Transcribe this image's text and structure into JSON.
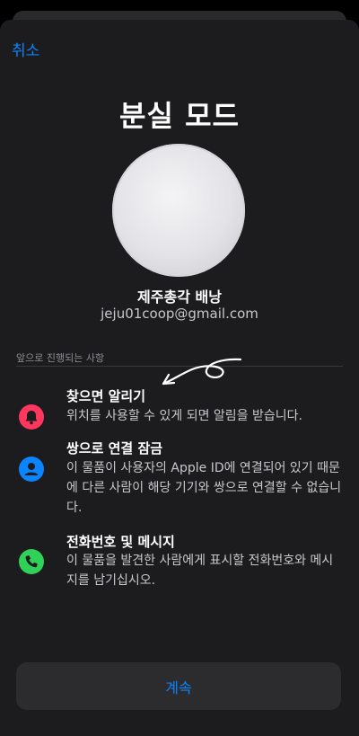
{
  "header": {
    "cancel_label": "취소"
  },
  "title": "분실 모드",
  "item": {
    "name": "제주총각 배낭",
    "email": "jeju01coop@gmail.com"
  },
  "section_header": "앞으로 진행되는 사항",
  "features": [
    {
      "title": "찾으면 알리기",
      "description": "위치를 사용할 수 있게 되면 알림을 받습니다.",
      "icon": "bell-icon",
      "color": "#ff375f"
    },
    {
      "title": "쌍으로 연결 잠금",
      "description": "이 물품이 사용자의 Apple ID에 연결되어 있기 때문에 다른 사람이 해당 기기와 쌍으로 연결할 수 없습니다.",
      "icon": "person-icon",
      "color": "#0a84ff"
    },
    {
      "title": "전화번호 및 메시지",
      "description": "이 물품을 발견한 사람에게 표시할 전화번호와 메시지를 남기십시오.",
      "icon": "phone-icon",
      "color": "#30d158"
    }
  ],
  "continue_label": "계속"
}
